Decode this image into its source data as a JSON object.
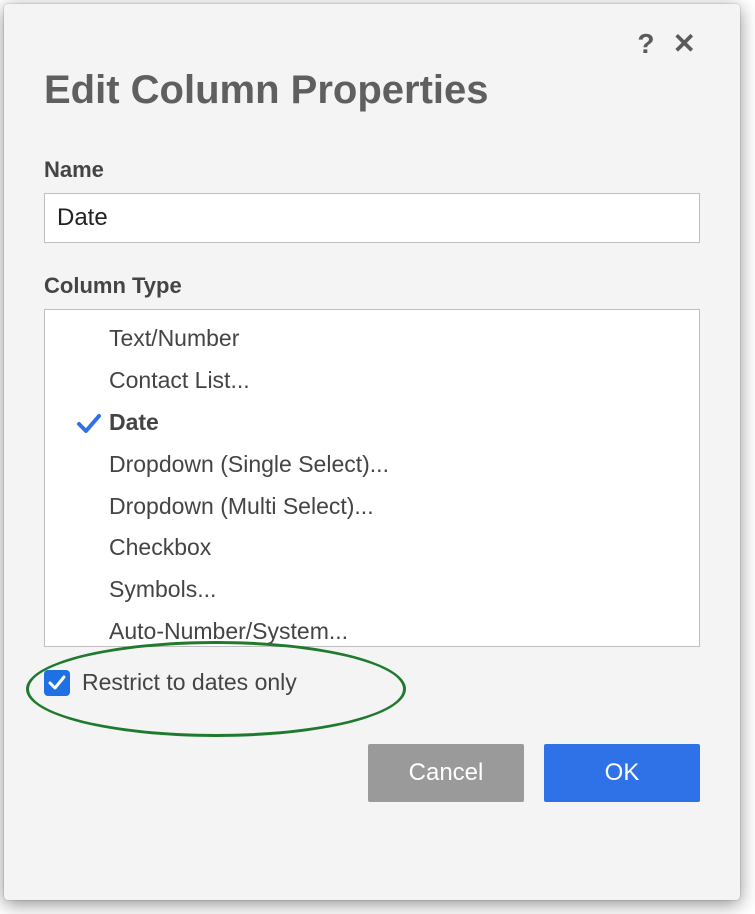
{
  "dialog": {
    "title": "Edit Column Properties",
    "help_icon": "?",
    "close_icon": "✕"
  },
  "name_field": {
    "label": "Name",
    "value": "Date"
  },
  "column_type": {
    "label": "Column Type",
    "items": [
      {
        "label": "Text/Number",
        "selected": false
      },
      {
        "label": "Contact List...",
        "selected": false
      },
      {
        "label": "Date",
        "selected": true
      },
      {
        "label": "Dropdown (Single Select)...",
        "selected": false
      },
      {
        "label": "Dropdown (Multi Select)...",
        "selected": false
      },
      {
        "label": "Checkbox",
        "selected": false
      },
      {
        "label": "Symbols...",
        "selected": false
      },
      {
        "label": "Auto-Number/System...",
        "selected": false
      }
    ]
  },
  "restrict": {
    "label": "Restrict to dates only",
    "checked": true
  },
  "buttons": {
    "cancel": "Cancel",
    "ok": "OK"
  }
}
